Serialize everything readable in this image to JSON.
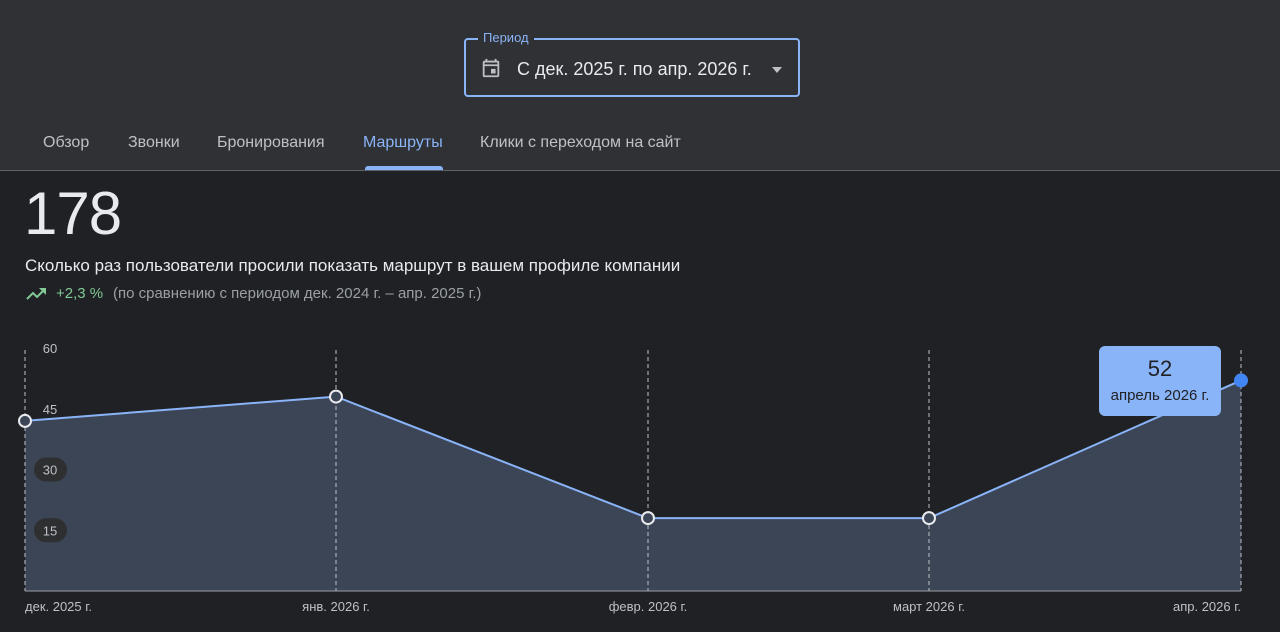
{
  "period": {
    "label": "Период",
    "value": "С дек. 2025 г. по апр. 2026 г."
  },
  "tabs": [
    {
      "label": "Обзор",
      "active": false
    },
    {
      "label": "Звонки",
      "active": false
    },
    {
      "label": "Бронирования",
      "active": false
    },
    {
      "label": "Маршруты",
      "active": true
    },
    {
      "label": "Клики с переходом на сайт",
      "active": false
    }
  ],
  "summary": {
    "total": "178",
    "description": "Сколько раз пользователи просили показать маршрут в вашем профиле компании",
    "trend_value": "+2,3 %",
    "trend_compare": "(по сравнению с периодом дек. 2024 г. – апр. 2025 г.)"
  },
  "tooltip": {
    "value": "52",
    "date": "апрель 2026 г."
  },
  "icons": {
    "period": "calendar-icon",
    "dropdown": "chevron-down-icon",
    "trend": "trending-up-icon"
  },
  "colors": {
    "accent": "#8ab4f8",
    "trend_up": "#81c995",
    "selected_point": "#4285f4",
    "area_fill": "#3c4556",
    "background": "#202124",
    "header_background": "#303134"
  },
  "chart_data": {
    "type": "area",
    "categories": [
      "дек. 2025 г.",
      "янв. 2026 г.",
      "февр. 2026 г.",
      "март 2026 г.",
      "апр. 2026 г."
    ],
    "series": [
      {
        "values": [
          42,
          48,
          18,
          18,
          52
        ]
      }
    ],
    "yticks": [
      "60",
      "45",
      "30",
      "15"
    ],
    "ylim": [
      0,
      60
    ],
    "selected_index": 4,
    "grid": "vertical-dashed"
  }
}
